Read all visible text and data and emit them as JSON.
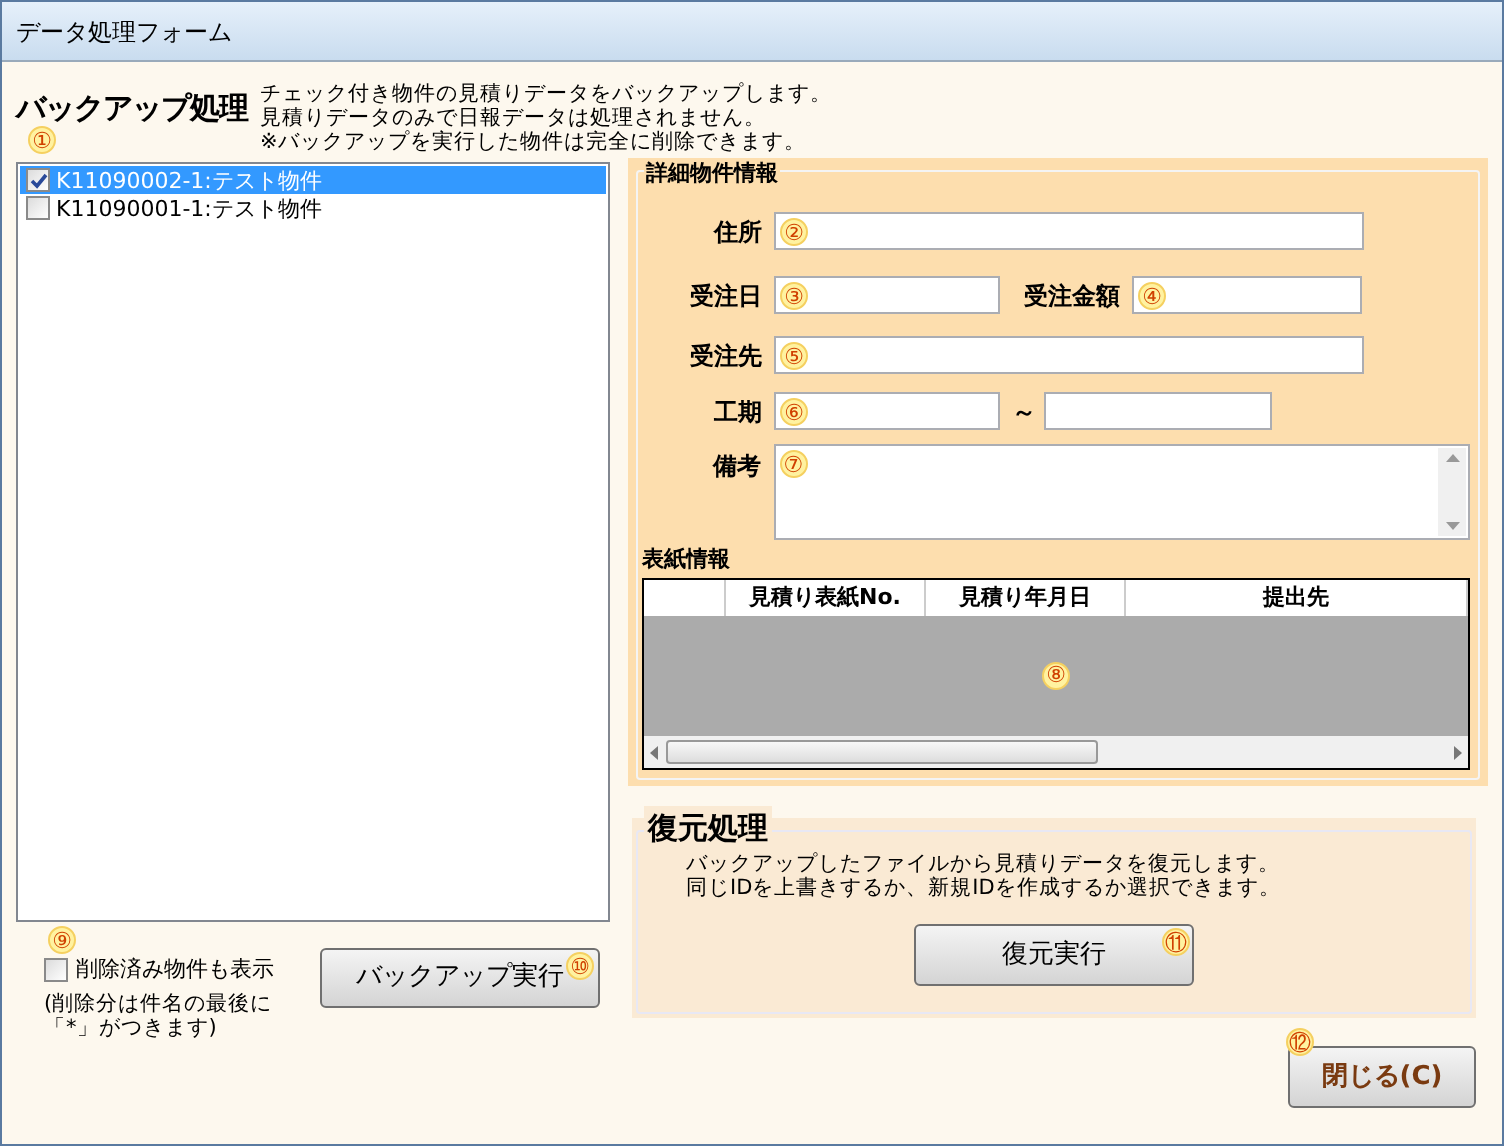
{
  "window": {
    "title": "データ処理フォーム"
  },
  "backup": {
    "title": "バックアップ処理",
    "description": [
      "チェック付き物件の見積りデータをバックアップします。",
      "見積りデータのみで日報データは処理されません。",
      "※バックアップを実行した物件は完全に削除できます。"
    ],
    "list_marker": "①",
    "items": [
      {
        "label": "K11090002-1:テスト物件",
        "checked": true,
        "selected": true
      },
      {
        "label": "K11090001-1:テスト物件",
        "checked": false,
        "selected": false
      }
    ],
    "show_deleted": {
      "marker": "⑨",
      "label": "削除済み物件も表示",
      "checked": false,
      "note": [
        "(削除分は件名の最後に",
        "「*」がつきます)"
      ]
    },
    "button": {
      "label": "バックアップ実行",
      "marker": "⑩"
    }
  },
  "details": {
    "title": "詳細物件情報",
    "address": {
      "label": "住所",
      "marker": "②"
    },
    "order_date": {
      "label": "受注日",
      "marker": "③"
    },
    "order_amount": {
      "label": "受注金額",
      "marker": "④"
    },
    "customer": {
      "label": "受注先",
      "marker": "⑤"
    },
    "period": {
      "label": "工期",
      "marker": "⑥",
      "separator": "～"
    },
    "remarks": {
      "label": "備考",
      "marker": "⑦"
    },
    "cover": {
      "title": "表紙情報",
      "columns": [
        "見積り表紙No.",
        "見積り年月日",
        "提出先"
      ],
      "marker": "⑧"
    }
  },
  "restore": {
    "title": "復元処理",
    "description": [
      "バックアップしたファイルから見積りデータを復元します。",
      "同じIDを上書きするか、新規IDを作成するか選択できます。"
    ],
    "button": {
      "label": "復元実行",
      "marker": "⑪"
    }
  },
  "close_button": {
    "label": "閉じる(C)",
    "marker": "⑫"
  }
}
